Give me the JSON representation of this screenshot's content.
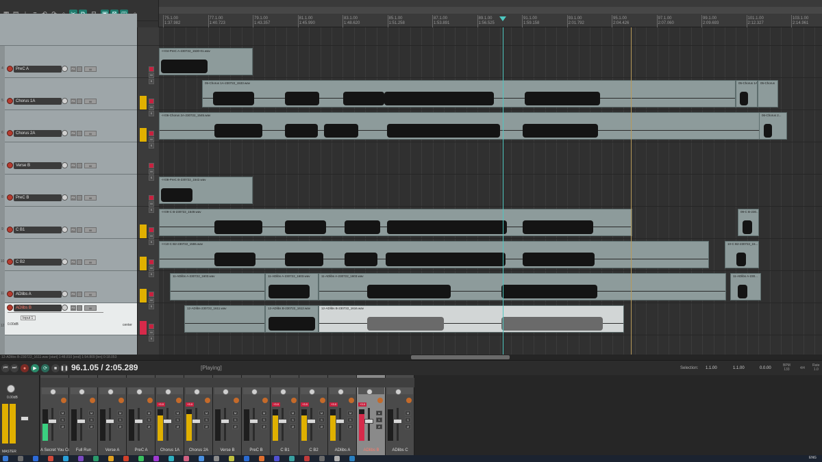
{
  "ruler": {
    "bars": [
      "75.1.00",
      "77.1.00",
      "79.1.00",
      "81.1.00",
      "83.1.00",
      "85.1.00",
      "87.1.00",
      "89.1.00",
      "91.1.00",
      "93.1.00",
      "95.1.00",
      "97.1.00",
      "99.1.00",
      "101.1.00",
      "103.1.00"
    ],
    "times": [
      "1:37.982",
      "1:40.723",
      "1:43.357",
      "1:45.990",
      "1:48.620",
      "1:51.258",
      "1:53.891",
      "1:56.525",
      "1:59.158",
      "2:01.792",
      "2:04.426",
      "2:07.060",
      "2:09.693",
      "2:12.327",
      "2:14.961"
    ]
  },
  "tracks": [
    {
      "num": "",
      "name": "",
      "selected": false
    },
    {
      "num": "4",
      "name": "PreC A",
      "selected": false
    },
    {
      "num": "5",
      "name": "Chorus 1A",
      "selected": false
    },
    {
      "num": "6",
      "name": "Chorus 2A",
      "selected": false
    },
    {
      "num": "7",
      "name": "Verse B",
      "selected": false
    },
    {
      "num": "8",
      "name": "PreC B",
      "selected": false
    },
    {
      "num": "9",
      "name": "C B1",
      "selected": false
    },
    {
      "num": "10",
      "name": "C B2",
      "selected": false
    },
    {
      "num": "11",
      "name": "ADlibs A",
      "selected": false
    },
    {
      "num": "12",
      "name": "ADlibs B",
      "selected": true,
      "input": "Input 1",
      "volume": "0.00dB",
      "pan": "center"
    },
    {
      "num": "13",
      "name": "ADlibs C",
      "selected": false
    }
  ],
  "items": [
    {
      "lane": 1,
      "label": "<<04-PreC A-230722_1530-01.wav"
    },
    {
      "lane": 2,
      "label": "05-Chorus 1A-230722_1533.wav"
    },
    {
      "lane": 2,
      "label": "05-Chorus 1A"
    },
    {
      "lane": 2,
      "label": "05-Chorus"
    },
    {
      "lane": 3,
      "label": "<<06-Chorus 2A-230722_1545.wav"
    },
    {
      "lane": 3,
      "label": "06-Chorus 2..."
    },
    {
      "lane": 5,
      "label": "<<08-PreC B-230722_1542.wav"
    },
    {
      "lane": 6,
      "label": "<<09-C B-230722_1549.wav"
    },
    {
      "lane": 6,
      "label": "09-C B-230..."
    },
    {
      "lane": 7,
      "label": "<<10-C B2-230722_1555.wav"
    },
    {
      "lane": 7,
      "label": "10-C B2-230722_15..."
    },
    {
      "lane": 8,
      "label": "11-ADlibs A-230722_1603.wav"
    },
    {
      "lane": 8,
      "label": "11-ADlibs A-230722_1603.wav"
    },
    {
      "lane": 8,
      "label": "11-ADlibs A-230722_1603.wav"
    },
    {
      "lane": 8,
      "label": "11-ADlibs A-230..."
    },
    {
      "lane": 9,
      "label": "12-ADlibs-230722_1611.wav"
    },
    {
      "lane": 9,
      "label": "12-ADlibs B-230722_1612.wav"
    },
    {
      "lane": 9,
      "label": "12-ADlibs B-230722_1616.wav"
    }
  ],
  "status_text": "12-ADlibs B-230722_1611.wav [start] 1:48.810 [end] 1:54.809 [len] 0:18.053",
  "transport": {
    "time": "96.1.05 / 2:05.289",
    "state": "[Playing]",
    "selection_label": "Selection:",
    "sel_start": "1.1.00",
    "sel_end": "1.1.00",
    "sel_len": "0.0.00",
    "bpm_label": "BPM",
    "bpm_value": "133",
    "timesig": "4/4",
    "rate_label": "Rate",
    "rate_value": "1.0"
  },
  "mixer": {
    "master_name": "MASTER",
    "master_vol": "0.00dB",
    "strips": [
      {
        "name": "A Secret You Co",
        "meter": 0.55,
        "meter_color": "green",
        "selected": false
      },
      {
        "name": "Full Run",
        "meter": 0.0,
        "meter_color": "yellow",
        "selected": false
      },
      {
        "name": "Verse A",
        "meter": 0.0,
        "meter_color": "yellow",
        "selected": false
      },
      {
        "name": "PreC A",
        "meter": 0.0,
        "meter_color": "yellow",
        "selected": false
      },
      {
        "name": "Chorus 1A",
        "meter": 0.8,
        "meter_color": "yellow",
        "selected": false
      },
      {
        "name": "Chorus 2A",
        "meter": 0.85,
        "meter_color": "yellow",
        "selected": false
      },
      {
        "name": "Verse B",
        "meter": 0.0,
        "meter_color": "yellow",
        "selected": false
      },
      {
        "name": "PreC B",
        "meter": 0.0,
        "meter_color": "yellow",
        "selected": false
      },
      {
        "name": "C B1",
        "meter": 0.8,
        "meter_color": "yellow",
        "selected": false
      },
      {
        "name": "C B2",
        "meter": 0.8,
        "meter_color": "yellow",
        "selected": false
      },
      {
        "name": "ADlibs A",
        "meter": 0.8,
        "meter_color": "yellow",
        "selected": false
      },
      {
        "name": "ADlibs B",
        "meter": 0.85,
        "meter_color": "red",
        "selected": true
      },
      {
        "name": "ADlibs C",
        "meter": 0.0,
        "meter_color": "yellow",
        "selected": false
      }
    ]
  },
  "taskbar": {
    "lang": "ENG"
  },
  "colors": {
    "accent": "#4ec7c0",
    "item": "#8d9b9b",
    "selected_track": "#e9ecec",
    "meter": "#e0b000"
  }
}
